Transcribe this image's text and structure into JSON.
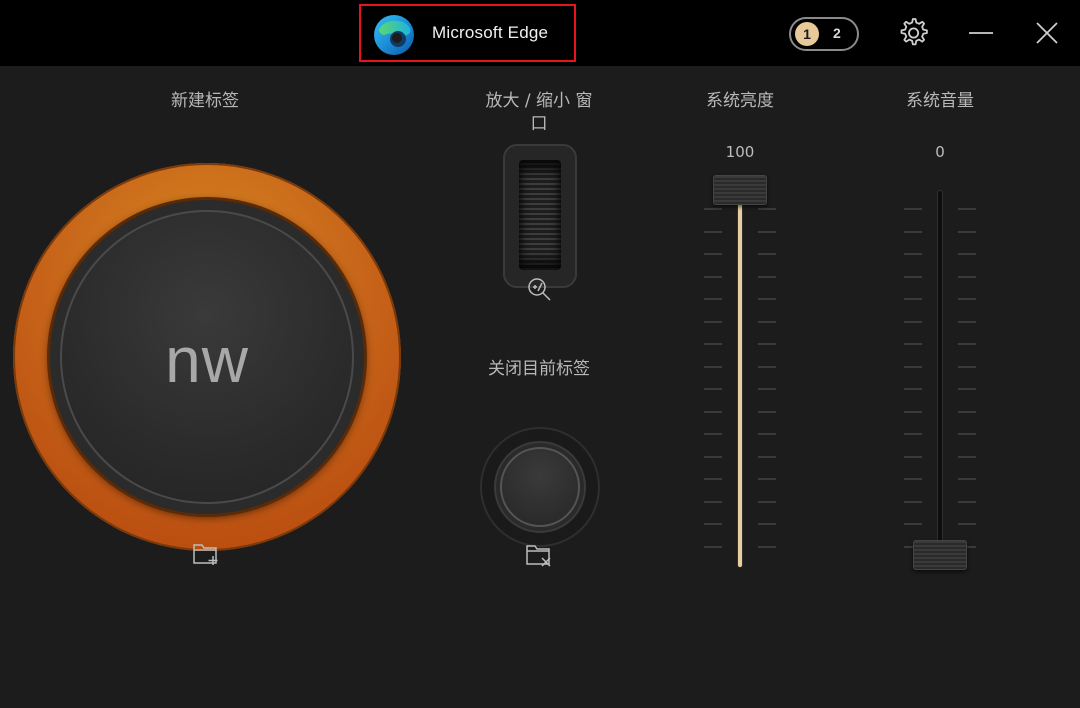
{
  "titlebar": {
    "app_name": "Microsoft Edge",
    "page_switch": {
      "page1": "1",
      "page2": "2",
      "active_page": 1
    },
    "icons": [
      "edge-logo-icon",
      "gear-icon",
      "minimize-icon",
      "close-icon"
    ]
  },
  "controls": {
    "new_tab": {
      "label": "新建标签",
      "knob_text": "nw",
      "icon": "new-tab-icon"
    },
    "zoom": {
      "label": "放大 / 缩小 窗口",
      "icon": "zoom-icon"
    },
    "close_tab": {
      "label": "关闭目前标签",
      "icon": "close-tab-icon"
    },
    "brightness": {
      "label": "系统亮度",
      "value": "100",
      "level": 100
    },
    "volume": {
      "label": "系统音量",
      "value": "0",
      "level": 0
    }
  },
  "colors": {
    "accent_ring": "#c8661a",
    "slider_fill": "#e8cfa2",
    "highlight_box": "#e8141c",
    "background": "#1c1c1c"
  }
}
